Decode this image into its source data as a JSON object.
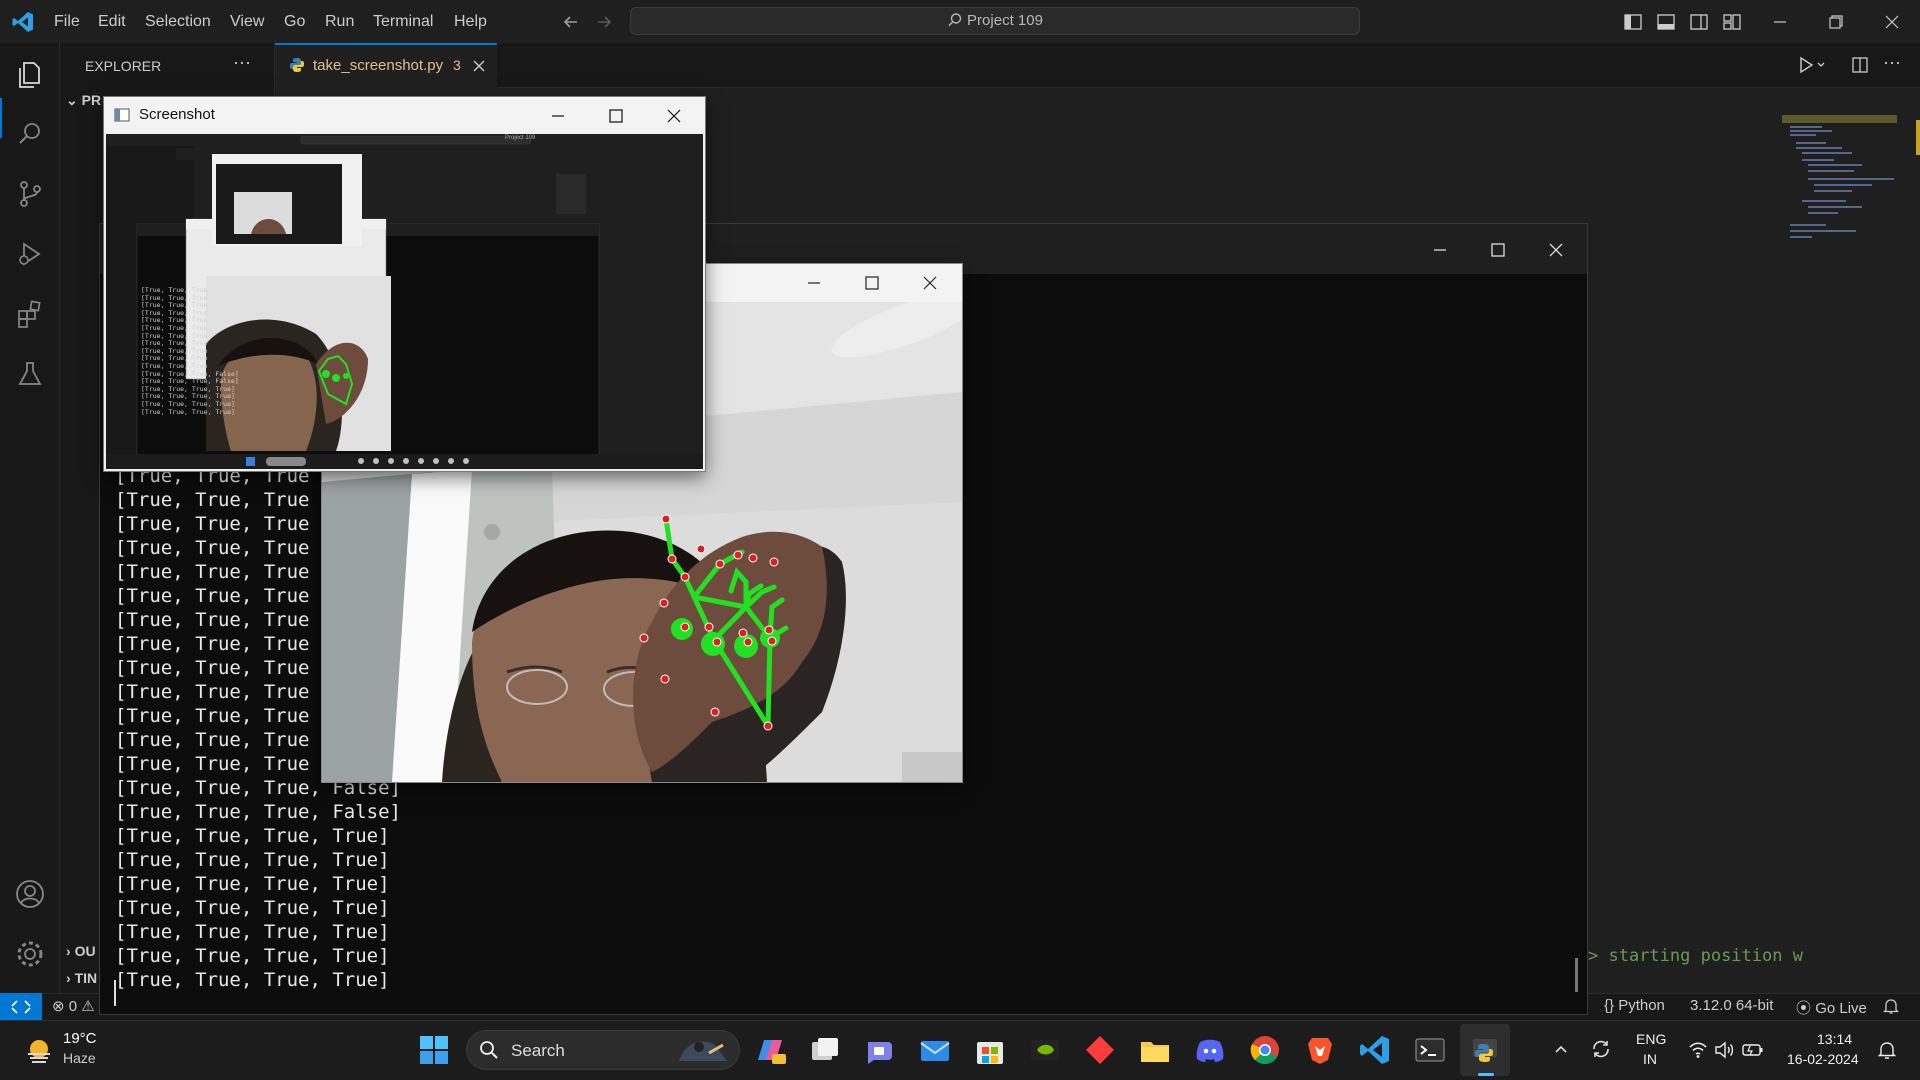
{
  "menu": {
    "file": "File",
    "edit": "Edit",
    "selection": "Selection",
    "view": "View",
    "go": "Go",
    "run": "Run",
    "terminal": "Terminal",
    "help": "Help"
  },
  "command_center": {
    "text": "Project 109",
    "icon": "search-icon"
  },
  "sidebar": {
    "title": "EXPLORER",
    "more": "···",
    "sections": {
      "project": "PR",
      "outline": "OU",
      "timeline": "TIN"
    }
  },
  "tab": {
    "filename": "take_screenshot.py",
    "problems": "3"
  },
  "editor": {
    "visible_code_fragment": "starting position w"
  },
  "console": {
    "lines": [
      "[True, True, True",
      "[True, True, True",
      "[True, True, True",
      "[True, True, True",
      "[True, True, True",
      "[True, True, True",
      "[True, True, True",
      "[True, True, True",
      "[True, True, True",
      "[True, True, True",
      "[True, True, True",
      "[True, True, True",
      "[True, True, True",
      "[True, True, True, False]",
      "[True, True, True, False]",
      "[True, True, True, True]",
      "[True, True, True, True]",
      "[True, True, True, True]",
      "[True, True, True, True]",
      "[True, True, True, True]",
      "[True, True, True, True]",
      "[True, True, True, True]"
    ]
  },
  "screenshot_window": {
    "title": "Screenshot",
    "nested_preview": {
      "command_center": "Project 109",
      "lines": [
        "[True, True, True",
        "[True, True, True",
        "[True, True, True",
        "[True, True, True",
        "[True, True, True",
        "[True, True, True",
        "[True, True, True",
        "[True, True, True",
        "[True, True, True",
        "[True, True, True",
        "[True, True, True",
        "[True, True, True, False]",
        "[True, True, True, False]",
        "[True, True, True, True]",
        "[True, True, True, True]",
        "[True, True, True, True]",
        "[True, True, True, True]"
      ]
    }
  },
  "status": {
    "errors": "0",
    "language": "Python",
    "interpreter": "3.12.0 64-bit",
    "golive": "Go Live"
  },
  "taskbar": {
    "weather_temp": "19°C",
    "weather_desc": "Haze",
    "search": "Search",
    "lang_top": "ENG",
    "lang_bottom": "IN",
    "time": "13:14",
    "date": "16-02-2024"
  },
  "colors": {
    "accent": "#0078d4",
    "landmark_line": "#22e022",
    "landmark_point": "#e02020",
    "tab_text": "#e2c08d"
  }
}
